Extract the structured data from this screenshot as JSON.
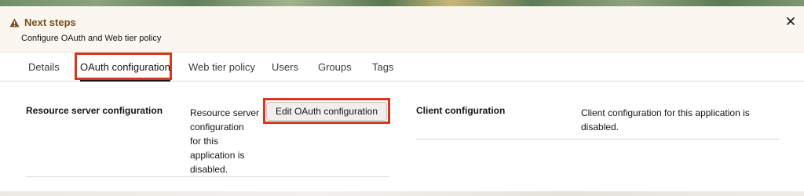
{
  "notice": {
    "title": "Next steps",
    "message": "Configure OAuth and Web tier policy",
    "icon": "warning-triangle-icon",
    "close_icon": "close-icon",
    "accent_color": "#7a4d1e"
  },
  "tabs": [
    {
      "label": "Details",
      "active": false
    },
    {
      "label": "OAuth configuration",
      "active": true
    },
    {
      "label": "Web tier policy",
      "active": false
    },
    {
      "label": "Users",
      "active": false
    },
    {
      "label": "Groups",
      "active": false
    },
    {
      "label": "Tags",
      "active": false
    }
  ],
  "resource_server": {
    "title": "Resource server configuration",
    "description_lines": [
      "Resource server",
      "configuration",
      "for this",
      "application is",
      "disabled."
    ],
    "edit_button_label": "Edit OAuth configuration"
  },
  "client": {
    "title": "Client configuration",
    "description_lines": [
      "Client configuration for this application is",
      "disabled."
    ]
  },
  "highlight_color": "#d9351f"
}
